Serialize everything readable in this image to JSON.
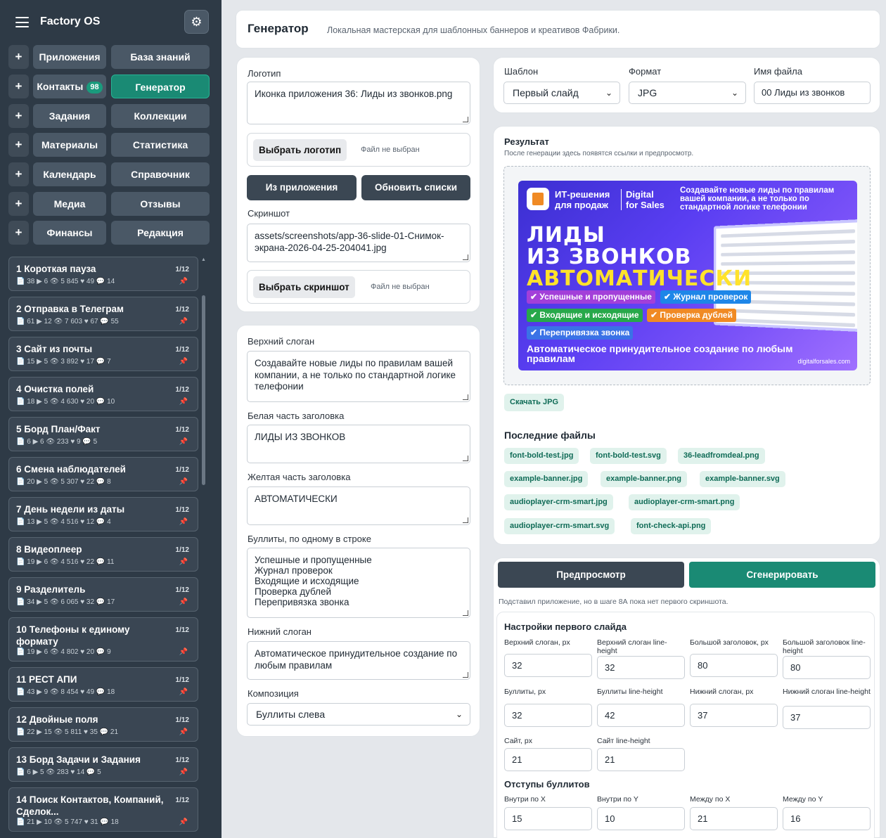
{
  "app": {
    "title": "Factory OS"
  },
  "nav": {
    "rows": [
      {
        "left": "Приложения",
        "right": "База знаний"
      },
      {
        "left": "Контакты",
        "badge": "98",
        "right": "Генератор"
      },
      {
        "left": "Задания",
        "right": "Коллекции"
      },
      {
        "left": "Материалы",
        "right": "Статистика"
      },
      {
        "left": "Календарь",
        "right": "Справочник"
      },
      {
        "left": "Медиа",
        "right": "Отзывы"
      },
      {
        "left": "Финансы",
        "right": "Редакция"
      }
    ],
    "active": "Генератор",
    "plus_glyph": "+"
  },
  "tasks": [
    {
      "title": "1 Короткая пауза",
      "count": "1/12",
      "stats": "📄 38  ▶ 6  👁 5 845  ♥ 49  💬 14"
    },
    {
      "title": "2 Отправка в Телеграм",
      "count": "1/12",
      "stats": "📄 61  ▶ 12  👁 7 603  ♥ 67  💬 55"
    },
    {
      "title": "3 Сайт из почты",
      "count": "1/12",
      "stats": "📄 15  ▶ 5  👁 3 892  ♥ 17  💬 7"
    },
    {
      "title": "4 Очистка полей",
      "count": "1/12",
      "stats": "📄 18  ▶ 5  👁 4 630  ♥ 20  💬 10"
    },
    {
      "title": "5 Борд План/Факт",
      "count": "1/12",
      "stats": "📄 6  ▶ 6  👁 233  ♥ 9  💬 5"
    },
    {
      "title": "6 Смена наблюдателей",
      "count": "1/12",
      "stats": "📄 20  ▶ 5  👁 5 307  ♥ 22  💬 8"
    },
    {
      "title": "7 День недели из даты",
      "count": "1/12",
      "stats": "📄 13  ▶ 5  👁 4 516  ♥ 12  💬 4"
    },
    {
      "title": "8 Видеоплеер",
      "count": "1/12",
      "stats": "📄 19  ▶ 6  👁 4 516  ♥ 22  💬 11"
    },
    {
      "title": "9 Разделитель",
      "count": "1/12",
      "stats": "📄 34  ▶ 5  👁 6 065  ♥ 32  💬 17"
    },
    {
      "title": "10 Телефоны к единому формату",
      "count": "1/12",
      "stats": "📄 19  ▶ 6  👁 4 802  ♥ 20  💬 9"
    },
    {
      "title": "11 РЕСТ АПИ",
      "count": "1/12",
      "stats": "📄 43  ▶ 9  👁 8 454  ♥ 49  💬 18"
    },
    {
      "title": "12 Двойные поля",
      "count": "1/12",
      "stats": "📄 22  ▶ 15  👁 5 811  ♥ 35  💬 21"
    },
    {
      "title": "13 Борд Задачи и Задания",
      "count": "1/12",
      "stats": "📄 6  ▶ 5  👁 283  ♥ 14  💬 5"
    },
    {
      "title": "14 Поиск Контактов, Компаний, Сделок...",
      "count": "1/12",
      "stats": "📄 21  ▶ 10  👁 5 747  ♥ 31  💬 18"
    }
  ],
  "header": {
    "title": "Генератор",
    "subtitle": "Локальная мастерская для шаблонных баннеров и креативов Фабрики."
  },
  "assets": {
    "logo_label": "Логотип",
    "logo_value": "Иконка приложения 36: Лиды из звонков.png",
    "logo_btn": "Выбрать логотип",
    "no_file": "Файл не выбран",
    "from_app": "Из приложения",
    "refresh": "Обновить списки",
    "screenshot_label": "Скриншот",
    "screenshot_value": "assets/screenshots/app-36-slide-01-Снимок-экрана-2026-04-25-204041.jpg",
    "screenshot_btn": "Выбрать скриншот"
  },
  "texts": {
    "top_label": "Верхний слоган",
    "top_value": "Создавайте новые лиды по правилам вашей компании, а не только по стандартной логике телефонии",
    "white_label": "Белая часть заголовка",
    "white_value": "ЛИДЫ ИЗ ЗВОНКОВ",
    "yellow_label": "Желтая часть заголовка",
    "yellow_value": "АВТОМАТИЧЕСКИ",
    "bullets_label": "Буллиты, по одному в строке",
    "bullets_value": "Успешные и пропущенные\nЖурнал проверок\nВходящие и исходящие\nПроверка дублей\nПерепривязка звонка",
    "bottom_label": "Нижний слоган",
    "bottom_value": "Автоматическое принудительное создание по любым правилам",
    "composition_label": "Композиция",
    "composition_value": "Буллиты слева"
  },
  "options": {
    "template_label": "Шаблон",
    "template_value": "Первый слайд",
    "format_label": "Формат",
    "format_value": "JPG",
    "filename_label": "Имя файла",
    "filename_value": "00 Лиды из звонков"
  },
  "result": {
    "title": "Результат",
    "hint": "После генерации здесь появятся ссылки и предпросмотр.",
    "download": "Скачать JPG",
    "recent_title": "Последние файлы",
    "files": [
      "font-bold-test.jpg",
      "font-bold-test.svg",
      "36-leadfromdeal.png",
      "example-banner.jpg",
      "example-banner.png",
      "example-banner.svg",
      "audioplayer-crm-smart.jpg",
      "audioplayer-crm-smart.png",
      "audioplayer-crm-smart.svg",
      "font-check-api.png"
    ]
  },
  "banner": {
    "brand_a": "ИТ-решения\nдля продаж",
    "brand_b": "Digital\nfor Sales",
    "top": "Создавайте новые лиды по правилам вашей компании, а не только по стандартной логике телефонии",
    "white": "ЛИДЫ\nИЗ ЗВОНКОВ",
    "yellow": "АВТОМАТИЧЕСКИ",
    "bullets": [
      "✔ Успешные и пропущенные",
      "✔ Журнал проверок",
      "✔ Входящие и исходящие",
      "✔ Проверка дублей",
      "✔ Перепривязка звонка"
    ],
    "bullet_colors": [
      "#a33fd9",
      "#1e86e8",
      "#27a84a",
      "#f08a24",
      "#3a72e6"
    ],
    "bottom": "Автоматическое принудительное создание по любым правилам",
    "site": "digitalforsales.com"
  },
  "actions": {
    "preview": "Предпросмотр",
    "generate": "Сгенерировать",
    "note": "Подставил приложение, но в шаге 8А пока нет первого скриншота."
  },
  "settings": {
    "title": "Настройки первого слайда",
    "fields": [
      {
        "label": "Верхний слоган, px",
        "value": "32"
      },
      {
        "label": "Верхний слоган line-height",
        "value": "32"
      },
      {
        "label": "Большой заголовок, px",
        "value": "80"
      },
      {
        "label": "Большой заголовок line-height",
        "value": "80"
      },
      {
        "label": "Буллиты, px",
        "value": "32"
      },
      {
        "label": "Буллиты line-height",
        "value": "42"
      },
      {
        "label": "Нижний слоган, px",
        "value": "37"
      },
      {
        "label": "Нижний слоган line-height",
        "value": "37"
      },
      {
        "label": "Сайт, px",
        "value": "21"
      },
      {
        "label": "Сайт line-height",
        "value": "21"
      }
    ],
    "padding_title": "Отступы буллитов",
    "padding_fields": [
      {
        "label": "Внутри по X",
        "value": "15"
      },
      {
        "label": "Внутри по Y",
        "value": "10"
      },
      {
        "label": "Между по X",
        "value": "21"
      },
      {
        "label": "Между по Y",
        "value": "16"
      }
    ]
  },
  "colors": {
    "accent": "#1a8a74",
    "sidebar": "#2e3a46",
    "chip_bg": "#e0f2ec",
    "chip_text": "#0f6b56",
    "pin": "#e04c6e"
  }
}
